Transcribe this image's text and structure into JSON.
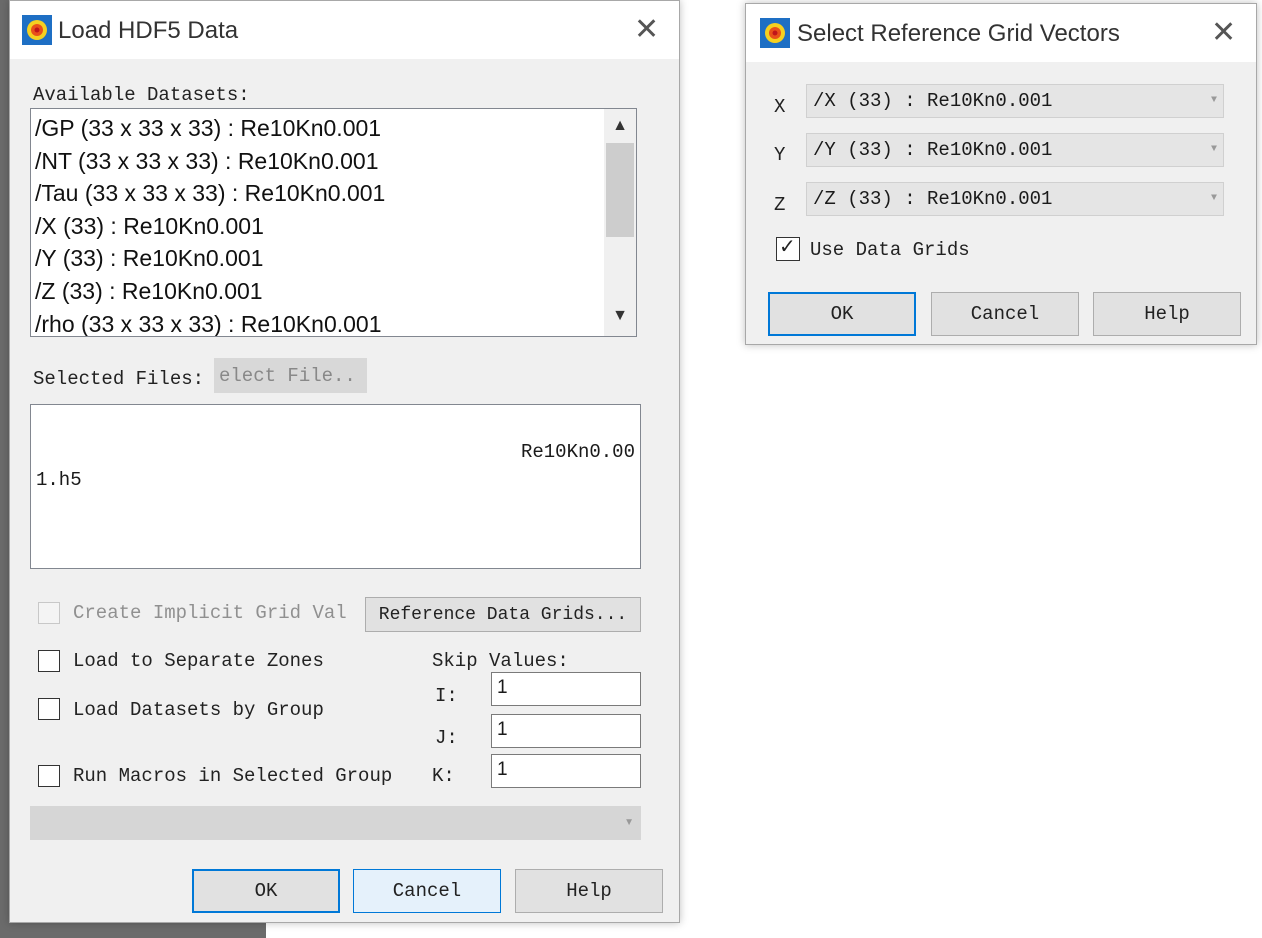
{
  "background": {
    "dark_strip_color": "#6b6b6b"
  },
  "load_dialog": {
    "title": "Load HDF5 Data",
    "available_label": "Available Datasets:",
    "datasets": [
      "/GP (33 x 33 x 33) : Re10Kn0.001",
      "/NT (33 x 33 x 33) : Re10Kn0.001",
      "/Tau (33 x 33 x 33) : Re10Kn0.001",
      "/X (33) : Re10Kn0.001",
      "/Y (33) : Re10Kn0.001",
      "/Z (33) : Re10Kn0.001",
      "/rho (33 x 33 x 33) : Re10Kn0.001"
    ],
    "selected_files_label": "Selected Files:",
    "select_file_button": "elect File..",
    "files_line1": "Re10Kn0.00",
    "files_line2": "1.h5",
    "create_implicit_label": "Create Implicit Grid Val",
    "reference_grids_button": "Reference Data Grids...",
    "load_separate_label": "Load to Separate Zones",
    "load_by_group_label": "Load Datasets by Group",
    "run_macros_label": "Run Macros in Selected Group",
    "skip_values_label": "Skip Values:",
    "skip_i_label": "I:",
    "skip_j_label": "J:",
    "skip_k_label": "K:",
    "skip_i": "1",
    "skip_j": "1",
    "skip_k": "1",
    "group_select": "",
    "ok": "OK",
    "cancel": "Cancel",
    "help": "Help"
  },
  "ref_dialog": {
    "title": "Select Reference Grid Vectors",
    "x_label": "X",
    "y_label": "Y",
    "z_label": "Z",
    "x_value": "/X (33) : Re10Kn0.001",
    "y_value": "/Y (33) : Re10Kn0.001",
    "z_value": "/Z (33) : Re10Kn0.001",
    "use_grids_label": "Use Data Grids",
    "use_grids_checked": true,
    "ok": "OK",
    "cancel": "Cancel",
    "help": "Help"
  }
}
